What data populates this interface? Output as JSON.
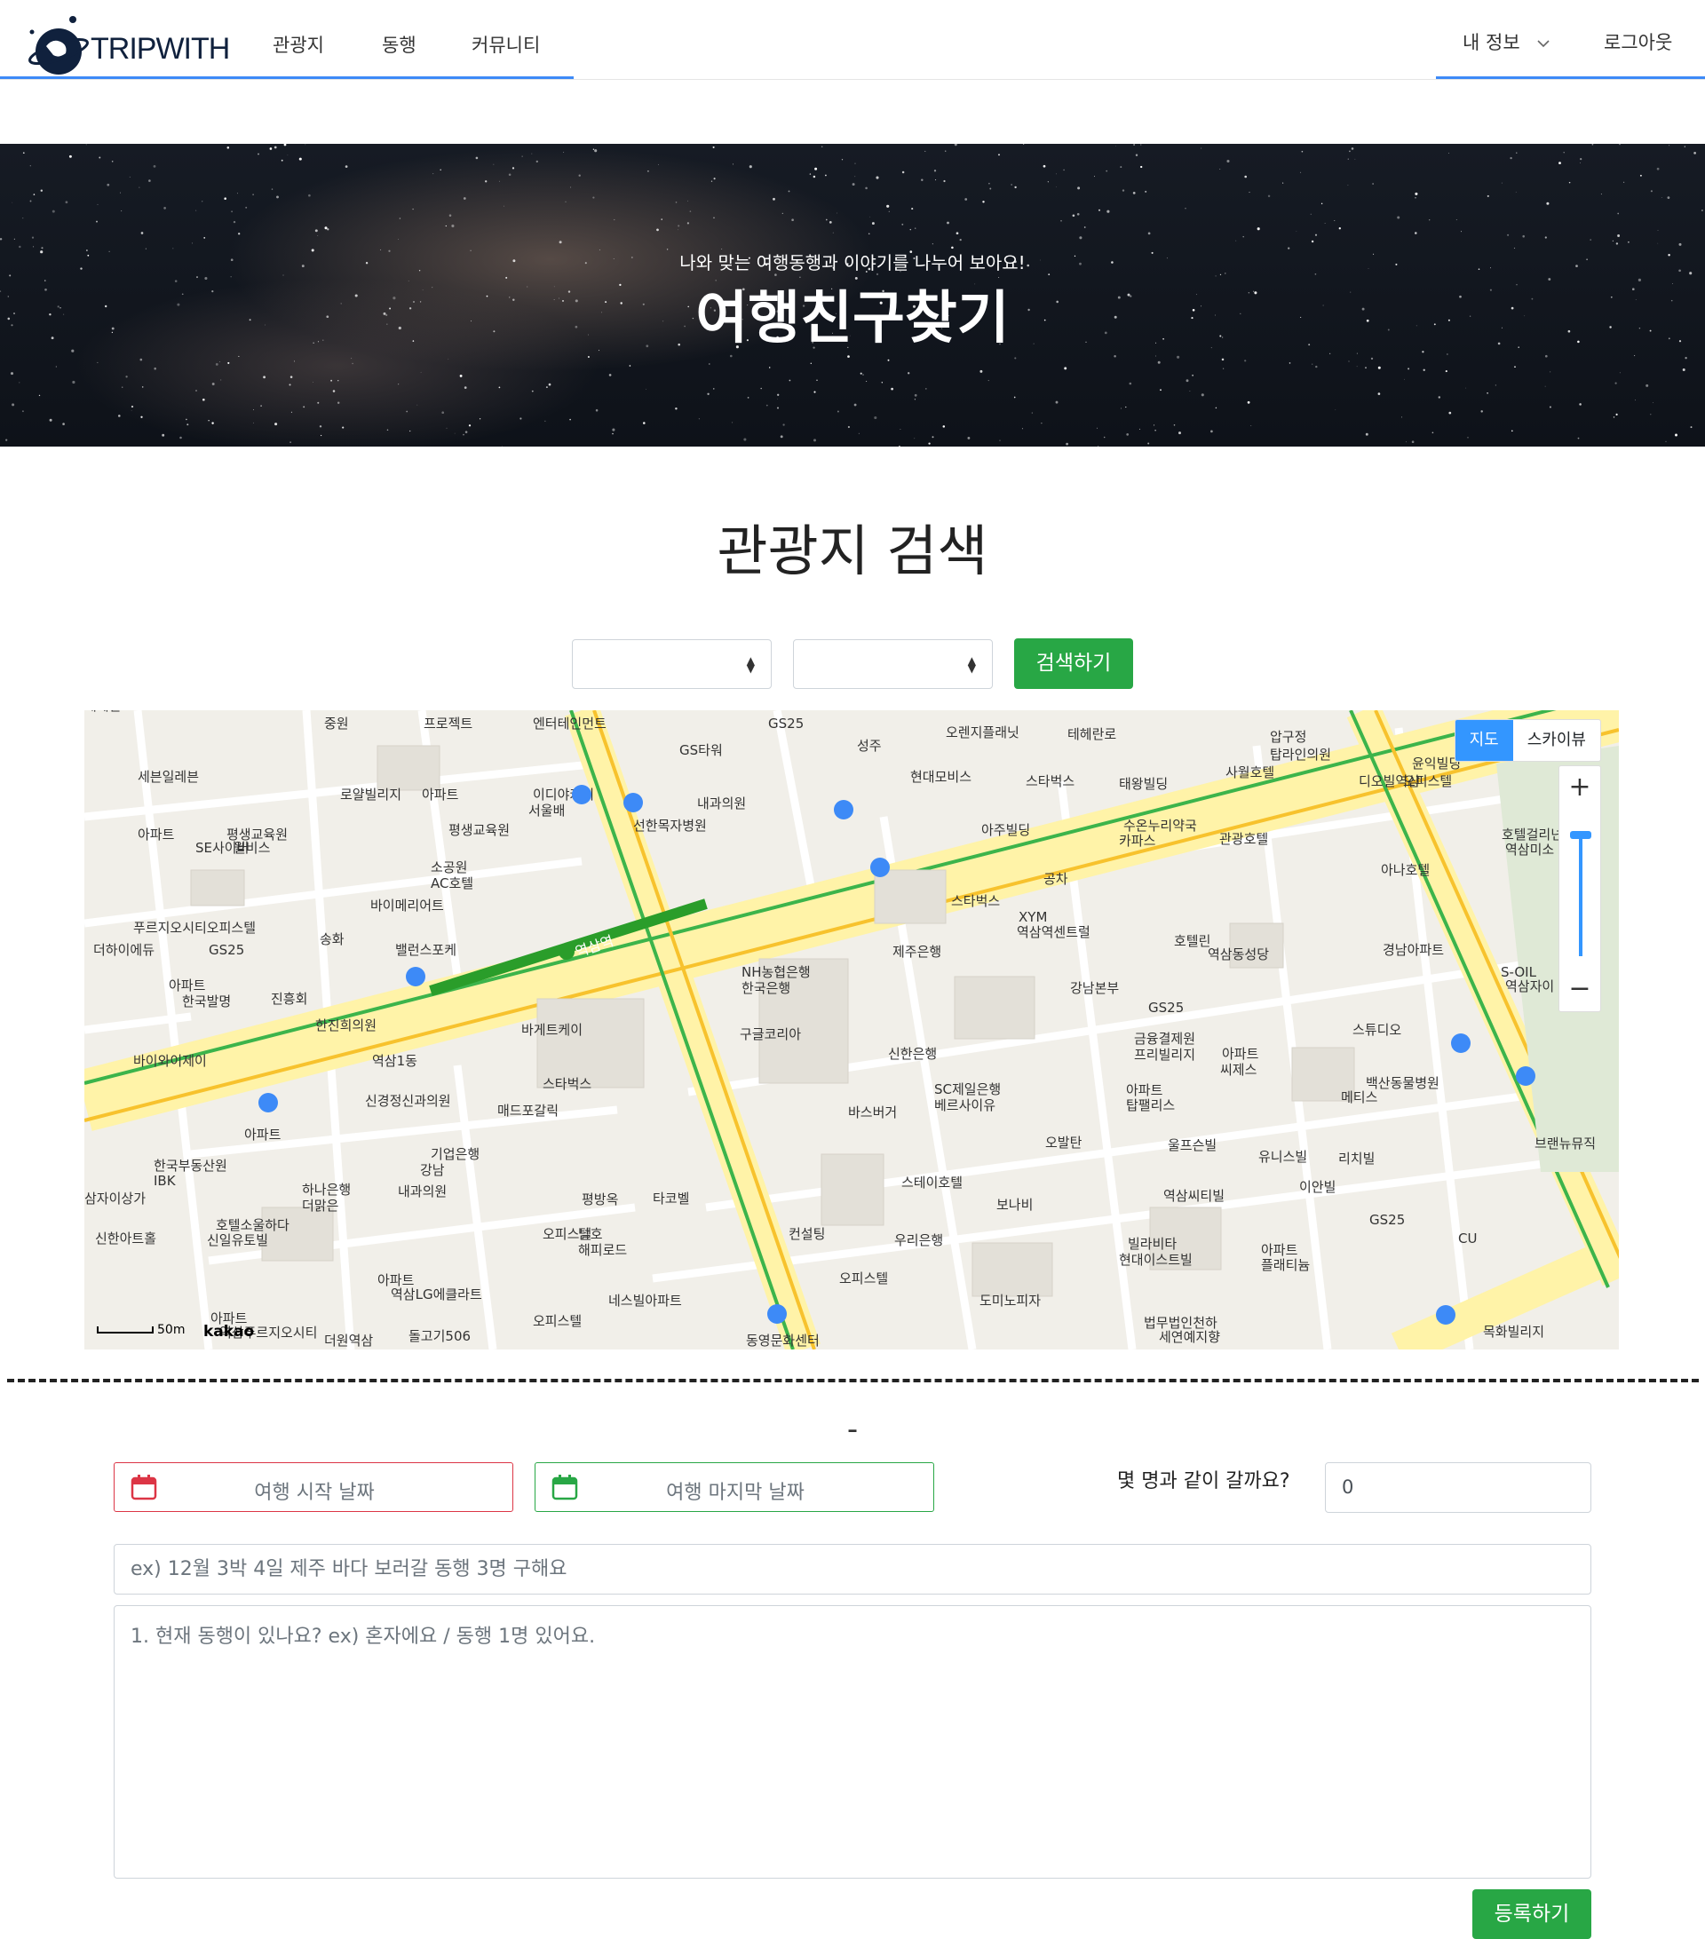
{
  "nav": {
    "logo_text": "TRIPWITH",
    "items": [
      {
        "label": "관광지"
      },
      {
        "label": "동행"
      },
      {
        "label": "커뮤니티"
      }
    ],
    "my_info": "내 정보",
    "logout": "로그아웃"
  },
  "hero": {
    "subtitle": "나와 맞는 여행동행과 이야기를 나누어 보아요!",
    "title": "여행친구찾기"
  },
  "search": {
    "heading": "관광지 검색",
    "select1_value": "",
    "select2_value": "",
    "button": "검색하기"
  },
  "map": {
    "type_map": "지도",
    "type_skyview": "스카이뷰",
    "zoom_in": "+",
    "zoom_out": "−",
    "scale": "50m",
    "provider": "kakao",
    "station": "역삼역",
    "labels": [
      "중원",
      "프로젝트",
      "엔터테인먼트",
      "GS타워",
      "GS25",
      "성주",
      "오렌지플래닛",
      "압구정",
      "탑라인의원",
      "윤익빌딩",
      "오피스텔",
      "세븐일레븐",
      "로얄빌리지",
      "아파트",
      "이디야커피",
      "서울배",
      "내과의원",
      "현대모비스",
      "스타벅스",
      "태왕빌딩",
      "사월호텔",
      "디오빌역삼",
      "아파트",
      "SE사이버",
      "평생교육원",
      "윌비스",
      "평생교육원",
      "선한목자병원",
      "아주빌딩",
      "수온누리약국",
      "카파스",
      "관광호텔",
      "호텔걸리넌",
      "역삼미소",
      "소공원",
      "AC호텔",
      "바이메리어트",
      "공차",
      "아나호텔",
      "스타벅스",
      "XYM",
      "역삼역센트럴",
      "푸르지오시티오피스텔",
      "송화",
      "더하이에듀",
      "GS25",
      "밸런스포케",
      "제주은행",
      "호텔린",
      "역삼동성당",
      "경남아파트",
      "S-OIL",
      "역삼자이",
      "아파트",
      "한국발명",
      "진흥회",
      "NH농협은행",
      "한국은행",
      "강남본부",
      "GS25",
      "바게트케이",
      "구글코리아",
      "금융결제원",
      "프리빌리지",
      "아파트",
      "씨제스",
      "스튜디오",
      "바이와이제이",
      "역삼1동",
      "신한은행",
      "백산동물병원",
      "메티스",
      "신경정신과의원",
      "스타벅스",
      "SC제일은행",
      "베르사이유",
      "아파트",
      "탑팰리스",
      "아파트",
      "매드포갈릭",
      "바스버거",
      "오발탄",
      "울프슨빌",
      "유니스빌",
      "리치빌",
      "한국부동산원",
      "IBK",
      "기업은행",
      "강남",
      "스테이호텔",
      "보나비",
      "역삼씨티빌",
      "이안빌",
      "브랜뉴뮤직",
      "삼자이상가",
      "하나은행",
      "더맑은",
      "내과의원",
      "평방옥",
      "타코벨",
      "GS25",
      "CU",
      "신한아트홀",
      "호텔소울하다",
      "신일유토빌",
      "오피스텔",
      "남호",
      "해피로드",
      "컨설팅",
      "우리은행",
      "빌라비타",
      "현대이스트빌",
      "아파트",
      "플래티늄",
      "아파트",
      "역삼LG에클라트",
      "오피스텔",
      "도미노피자",
      "네스빌아파트",
      "법무법인천하",
      "세연예지향",
      "아파트",
      "역삼푸르지오시티",
      "오피스텔",
      "돌고기506",
      "목화빌리지",
      "동영문화센터",
      "더원역삼",
      "한진희의원",
      "테헤란로",
      "테헤란로"
    ]
  },
  "form": {
    "start_date_placeholder": "여행 시작 날짜",
    "end_date_placeholder": "여행 마지막 날짜",
    "people_label": "몇 명과 같이 갈까요?",
    "people_value": "0",
    "title_placeholder": "ex) 12월 3박 4일 제주 바다 보러갈 동행 3명 구해요",
    "content_placeholder": "1. 현재 동행이 있나요? ex) 혼자에요 / 동행 1명 있어요.",
    "separator": "-",
    "submit": "등록하기"
  },
  "colors": {
    "accent_blue": "#3d8af7",
    "success_green": "#28a745",
    "danger_red": "#dc3545",
    "map_blue": "#3396ff"
  }
}
